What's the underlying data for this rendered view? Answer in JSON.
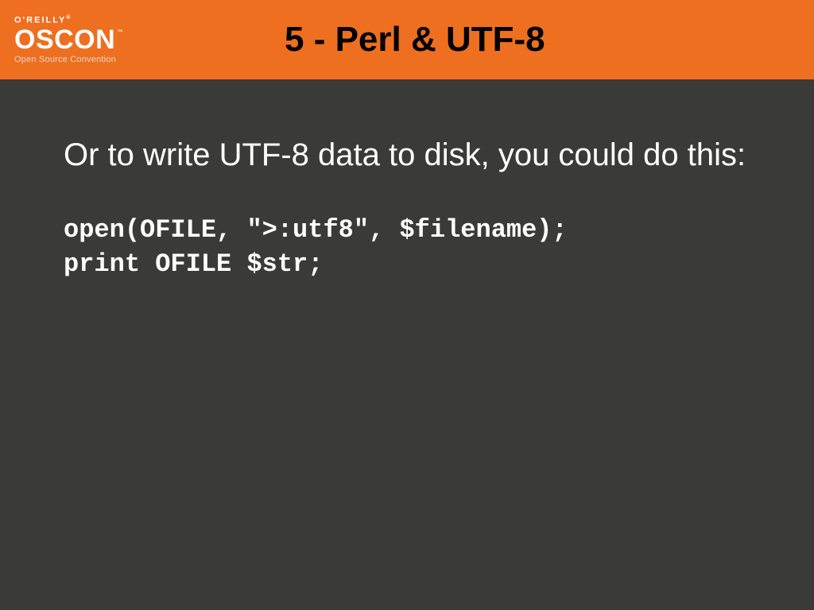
{
  "header": {
    "brand_top": "O'REILLY",
    "brand_main": "OSCON",
    "brand_tm": "™",
    "brand_tagline": "Open Source Convention",
    "title": "5 - Perl & UTF-8"
  },
  "content": {
    "paragraph": "Or to write UTF-8 data to disk, you could do this:",
    "code": "open(OFILE, \">:utf8\", $filename);\nprint OFILE $str;"
  }
}
